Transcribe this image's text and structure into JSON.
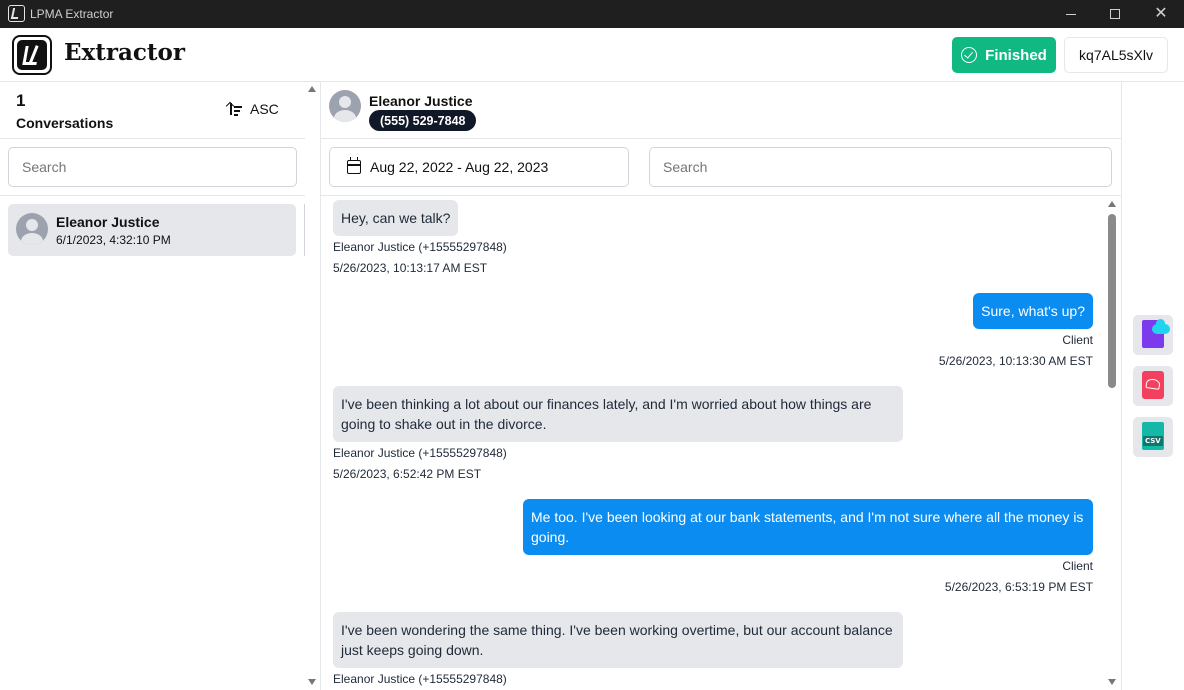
{
  "window": {
    "title": "LPMA Extractor"
  },
  "header": {
    "brand": "Extractor",
    "status_label": "Finished",
    "session_id": "kq7AL5sXlv"
  },
  "sidebar": {
    "count": "1",
    "count_label": "Conversations",
    "sort_label": "ASC",
    "search_placeholder": "Search",
    "conversations": [
      {
        "name": "Eleanor Justice",
        "date": "6/1/2023, 4:32:10 PM"
      }
    ]
  },
  "conversation": {
    "contact_name": "Eleanor Justice",
    "phone": "(555) 529-7848",
    "date_range": "Aug 22, 2022 - Aug 22, 2023",
    "search_placeholder": "Search"
  },
  "messages": [
    {
      "direction": "in",
      "text": "Hey, can we talk?",
      "sender": "Eleanor Justice (+15555297848)",
      "time": "5/26/2023, 10:13:17 AM EST"
    },
    {
      "direction": "out",
      "text": "Sure, what's up?",
      "sender": "Client",
      "time": "5/26/2023, 10:13:30 AM EST"
    },
    {
      "direction": "in",
      "text": "I've been thinking a lot about our finances lately, and I'm worried about how things are going to shake out in the divorce.",
      "sender": "Eleanor Justice (+15555297848)",
      "time": "5/26/2023, 6:52:42 PM EST"
    },
    {
      "direction": "out",
      "text": "Me too. I've been looking at our bank statements, and I'm not sure where all the money is going.",
      "sender": "Client",
      "time": "5/26/2023, 6:53:19 PM EST"
    },
    {
      "direction": "in",
      "text": "I've been wondering the same thing. I've been working overtime, but our account balance just keeps going down.",
      "sender": "Eleanor Justice (+15555297848)",
      "time": ""
    }
  ],
  "export": {
    "icons": [
      "cloud-export-icon",
      "pdf-export-icon",
      "csv-export-icon"
    ],
    "csv_label": "CSV"
  },
  "colors": {
    "accent_green": "#10b981",
    "outgoing_bubble": "#0a8cf0",
    "incoming_bubble": "#e5e7eb",
    "titlebar": "#1f1f1f"
  }
}
